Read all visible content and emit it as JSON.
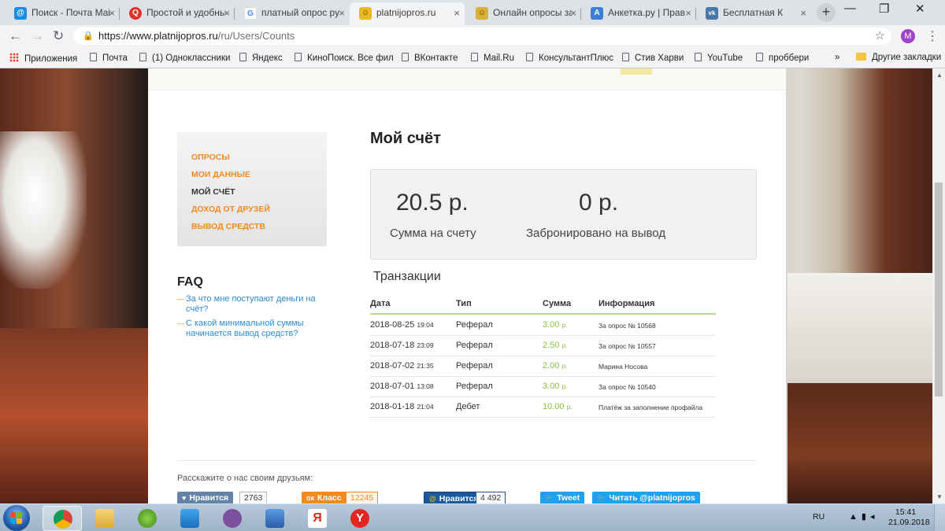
{
  "browser": {
    "tabs": [
      {
        "label": "Поиск - Почта Mail.Ru",
        "favicon": "mail-icon",
        "favicon_color": "#168de2"
      },
      {
        "label": "Простой и удобный",
        "favicon": "q-icon",
        "favicon_color": "#e0342b"
      },
      {
        "label": "платный опрос ру",
        "favicon": "google-icon",
        "favicon_color": "#4285f4"
      },
      {
        "label": "platnijopros.ru",
        "favicon": "platnijopros-icon",
        "favicon_color": "#e8b923"
      },
      {
        "label": "Онлайн опросы за",
        "favicon": "platnijopros-icon",
        "favicon_color": "#d9b13a"
      },
      {
        "label": "Анкетка.ру | Прав",
        "favicon": "anketka-icon",
        "favicon_color": "#3d7fd6"
      },
      {
        "label": "Бесплатная К",
        "favicon": "vk-icon",
        "favicon_color": "#4a76a8"
      }
    ],
    "url_host": "https://www.platnijopros.ru",
    "url_path": "/ru/Users/Counts",
    "profile_initial": "M",
    "bookmarks": [
      {
        "label": "Приложения",
        "icon": "apps-icon"
      },
      {
        "label": "Почта",
        "icon": "page-icon"
      },
      {
        "label": "(1) Одноклассники",
        "icon": "page-icon"
      },
      {
        "label": "Яндекс",
        "icon": "page-icon"
      },
      {
        "label": "КиноПоиск. Все фил",
        "icon": "page-icon"
      },
      {
        "label": "ВКонтакте",
        "icon": "page-icon"
      },
      {
        "label": "Mail.Ru",
        "icon": "page-icon"
      },
      {
        "label": "КонсультантПлюс",
        "icon": "page-icon"
      },
      {
        "label": "Стив Харви",
        "icon": "page-icon"
      },
      {
        "label": "YouTube",
        "icon": "page-icon"
      },
      {
        "label": "проббери",
        "icon": "page-icon"
      }
    ],
    "other_bookmarks": "Другие закладки",
    "overflow": "»"
  },
  "site": {
    "menu": [
      "ОПРОСЫ",
      "МОИ ДАННЫЕ",
      "МОЙ СЧЁТ",
      "ДОХОД ОТ ДРУЗЕЙ",
      "ВЫВОД СРЕДСТВ"
    ],
    "faq_title": "FAQ",
    "faq": [
      "За что мне поступают деньги на счёт?",
      "С какой минимальной суммы начинается вывод средств?"
    ],
    "page_title": "Мой счёт",
    "balance": {
      "amount": "20.5 р.",
      "label": "Сумма на счету"
    },
    "reserved": {
      "amount": "0 р.",
      "label": "Забронировано на вывод"
    },
    "transactions_title": "Транзакции",
    "columns": [
      "Дата",
      "Тип",
      "Сумма",
      "Информация"
    ],
    "transactions": [
      {
        "date": "2018-08-25",
        "time": "19:04",
        "type": "Реферал",
        "sum": "3.00",
        "cur": "р.",
        "info": "За опрос № 10568"
      },
      {
        "date": "2018-07-18",
        "time": "23:09",
        "type": "Реферал",
        "sum": "2.50",
        "cur": "р.",
        "info": "За опрос № 10557"
      },
      {
        "date": "2018-07-02",
        "time": "21:35",
        "type": "Реферал",
        "sum": "2.00",
        "cur": "р.",
        "info": "Марина Носова"
      },
      {
        "date": "2018-07-01",
        "time": "13:08",
        "type": "Реферал",
        "sum": "3.00",
        "cur": "р.",
        "info": "За опрос № 10540"
      },
      {
        "date": "2018-01-18",
        "time": "21:04",
        "type": "Дебет",
        "sum": "10.00",
        "cur": "р.",
        "info": "Платёж за заполнение профайла"
      }
    ],
    "share_text": "Расскажите о нас своим друзьям:",
    "share": {
      "vk_like": "Нравится",
      "vk_count": "2763",
      "ok_class": "Класс",
      "ok_count": "12245",
      "mail_like": "Нравится",
      "mail_count": "4 492",
      "tweet": "Tweet",
      "follow": "Читать @platnijopros"
    }
  },
  "taskbar": {
    "language": "RU",
    "time": "15:41",
    "date": "21.09.2018"
  }
}
